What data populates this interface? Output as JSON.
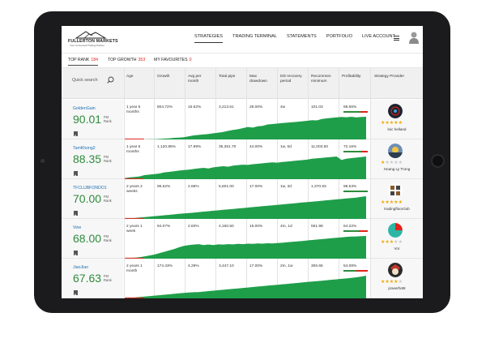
{
  "header": {
    "logo_brand": "FULLERTON MARKETS",
    "logo_tag": "Your Connected Trading Partner",
    "nav": [
      {
        "label": "STRATEGIES",
        "active": true
      },
      {
        "label": "TRADING TERMINAL",
        "active": false
      },
      {
        "label": "STATEMENTS",
        "active": false
      },
      {
        "label": "PORTFOLIO",
        "active": false
      },
      {
        "label": "LIVE ACCOUNT",
        "active": false
      }
    ]
  },
  "rank_tabs": [
    {
      "label": "TOP RANK",
      "count": "184",
      "active": true
    },
    {
      "label": "TOP GROWTH",
      "count": "353",
      "active": false
    },
    {
      "label": "MY FAVOURITES",
      "count": "0",
      "active": false
    }
  ],
  "table": {
    "search_placeholder": "Quick search",
    "columns": [
      "Age",
      "Growth",
      "Avg per month",
      "Total pips",
      "Max drawdown",
      "DD recovery period",
      "Recommen minimum",
      "Profitability",
      "Strategy Provider"
    ],
    "rank_label": "FM Rank",
    "rows": [
      {
        "name": "GoldenGain",
        "rank": "90.01",
        "age": "1 year 5 months",
        "growth": "804.72%",
        "avg": "15.62%",
        "pips": "3,213.61",
        "drawdown": "28.00%",
        "dd_recovery": "4w",
        "minimum": "101.03",
        "profitability": "68.66%",
        "profit_fraction": 0.6866,
        "stars": 5,
        "provider": "loic helland",
        "spark": [
          0,
          0,
          0,
          0,
          0,
          0.01,
          0.01,
          0.02,
          0.04,
          0.05,
          0.07,
          0.08,
          0.1,
          0.14,
          0.18,
          0.2,
          0.22,
          0.24,
          0.27,
          0.3,
          0.33,
          0.38,
          0.42,
          0.45,
          0.5,
          0.55,
          0.52,
          0.58,
          0.6,
          0.66,
          0.68,
          0.7,
          0.72,
          0.74,
          0.76,
          0.78,
          0.8,
          0.82,
          0.85,
          0.84,
          0.9,
          0.93,
          0.95,
          0.97,
          0.99,
          0.98,
          1.0,
          0.97,
          0.99,
          1.0
        ]
      },
      {
        "name": "TamKhong2",
        "rank": "88.35",
        "age": "1 year 5 months",
        "growth": "1,120.85%",
        "avg": "17.89%",
        "pips": "35,361.70",
        "drawdown": "44.00%",
        "dd_recovery": "1w, 6d",
        "minimum": "11,003.60",
        "profitability": "72.16%",
        "profit_fraction": 0.7216,
        "stars": 1,
        "provider": "Hoang Ly Trong",
        "spark": [
          0.05,
          0.08,
          0.1,
          0.12,
          0.18,
          0.2,
          0.22,
          0.25,
          0.3,
          0.32,
          0.35,
          0.38,
          0.4,
          0.42,
          0.45,
          0.48,
          0.5,
          0.47,
          0.52,
          0.55,
          0.57,
          0.55,
          0.6,
          0.62,
          0.64,
          0.63,
          0.66,
          0.68,
          0.7,
          0.72,
          0.74,
          0.73,
          0.76,
          0.78,
          0.8,
          0.82,
          0.84,
          0.86,
          0.9,
          0.92,
          0.94,
          0.96,
          0.98,
          1.0,
          0.85,
          0.9,
          0.93,
          0.95,
          0.97,
          1.0
        ]
      },
      {
        "name": "TFCLUBFONDO1",
        "rank": "70.00",
        "age": "2 years 2 weeks",
        "growth": "96.52%",
        "avg": "2.69%",
        "pips": "5,601.00",
        "drawdown": "17.00%",
        "dd_recovery": "1w, 3d",
        "minimum": "1,370.93",
        "profitability": "98.53%",
        "profit_fraction": 0.9853,
        "stars": 5,
        "provider": "tradingfloorclub",
        "spark": [
          0,
          0.02,
          0.04,
          0.06,
          0.08,
          0.1,
          0.12,
          0.14,
          0.16,
          0.18,
          0.2,
          0.22,
          0.24,
          0.26,
          0.28,
          0.3,
          0.32,
          0.34,
          0.36,
          0.38,
          0.4,
          0.42,
          0.44,
          0.46,
          0.48,
          0.5,
          0.52,
          0.54,
          0.56,
          0.58,
          0.6,
          0.62,
          0.64,
          0.66,
          0.68,
          0.7,
          0.72,
          0.74,
          0.76,
          0.78,
          0.8,
          0.82,
          0.84,
          0.86,
          0.88,
          0.9,
          0.92,
          0.94,
          0.97,
          1.0
        ]
      },
      {
        "name": "Vine",
        "rank": "68.00",
        "age": "2 years 1 week",
        "growth": "94.07%",
        "avg": "2.83%",
        "pips": "4,160.50",
        "drawdown": "15.00%",
        "dd_recovery": "4m, 1d",
        "minimum": "551.98",
        "profitability": "64.22%",
        "profit_fraction": 0.6422,
        "stars": 3,
        "provider": "Vor",
        "spark": [
          0,
          0.02,
          0.04,
          0.06,
          0.1,
          0.14,
          0.18,
          0.24,
          0.3,
          0.36,
          0.42,
          0.5,
          0.56,
          0.6,
          0.62,
          0.64,
          0.6,
          0.62,
          0.6,
          0.63,
          0.62,
          0.64,
          0.63,
          0.65,
          0.64,
          0.66,
          0.65,
          0.67,
          0.66,
          0.68,
          0.67,
          0.69,
          0.7,
          0.72,
          0.74,
          0.76,
          0.78,
          0.8,
          0.82,
          0.84,
          0.86,
          0.88,
          0.9,
          0.92,
          0.94,
          0.96,
          0.97,
          0.98,
          0.99,
          1.0
        ]
      },
      {
        "name": "JiaoJiao",
        "rank": "67.63",
        "age": "2 years 1 month",
        "growth": "174.43%",
        "avg": "4.29%",
        "pips": "3,447.10",
        "drawdown": "17.00%",
        "dd_recovery": "2m, 1w",
        "minimum": "306.65",
        "profitability": "54.08%",
        "profit_fraction": 0.5408,
        "stars": 4,
        "provider": "powerfx88",
        "spark": [
          0,
          0.02,
          0.04,
          0.06,
          0.08,
          0.1,
          0.12,
          0.14,
          0.16,
          0.18,
          0.2,
          0.22,
          0.24,
          0.26,
          0.27,
          0.28,
          0.3,
          0.32,
          0.34,
          0.36,
          0.38,
          0.4,
          0.42,
          0.44,
          0.46,
          0.48,
          0.5,
          0.52,
          0.54,
          0.56,
          0.58,
          0.6,
          0.62,
          0.64,
          0.66,
          0.68,
          0.7,
          0.72,
          0.74,
          0.76,
          0.78,
          0.8,
          0.82,
          0.84,
          0.86,
          0.88,
          0.9,
          0.93,
          0.96,
          1.0
        ]
      }
    ]
  },
  "colors": {
    "accent_green": "#2e8b3c",
    "chart_green": "#1f9e4a",
    "link_blue": "#1f6fb2",
    "count_red": "#e2231a",
    "star_gold": "#f2a900"
  },
  "avatars": [
    "dark-circle-avatar",
    "sunrise-avatar",
    "grid-logo-avatar",
    "teal-pie-avatar",
    "joker-avatar"
  ]
}
